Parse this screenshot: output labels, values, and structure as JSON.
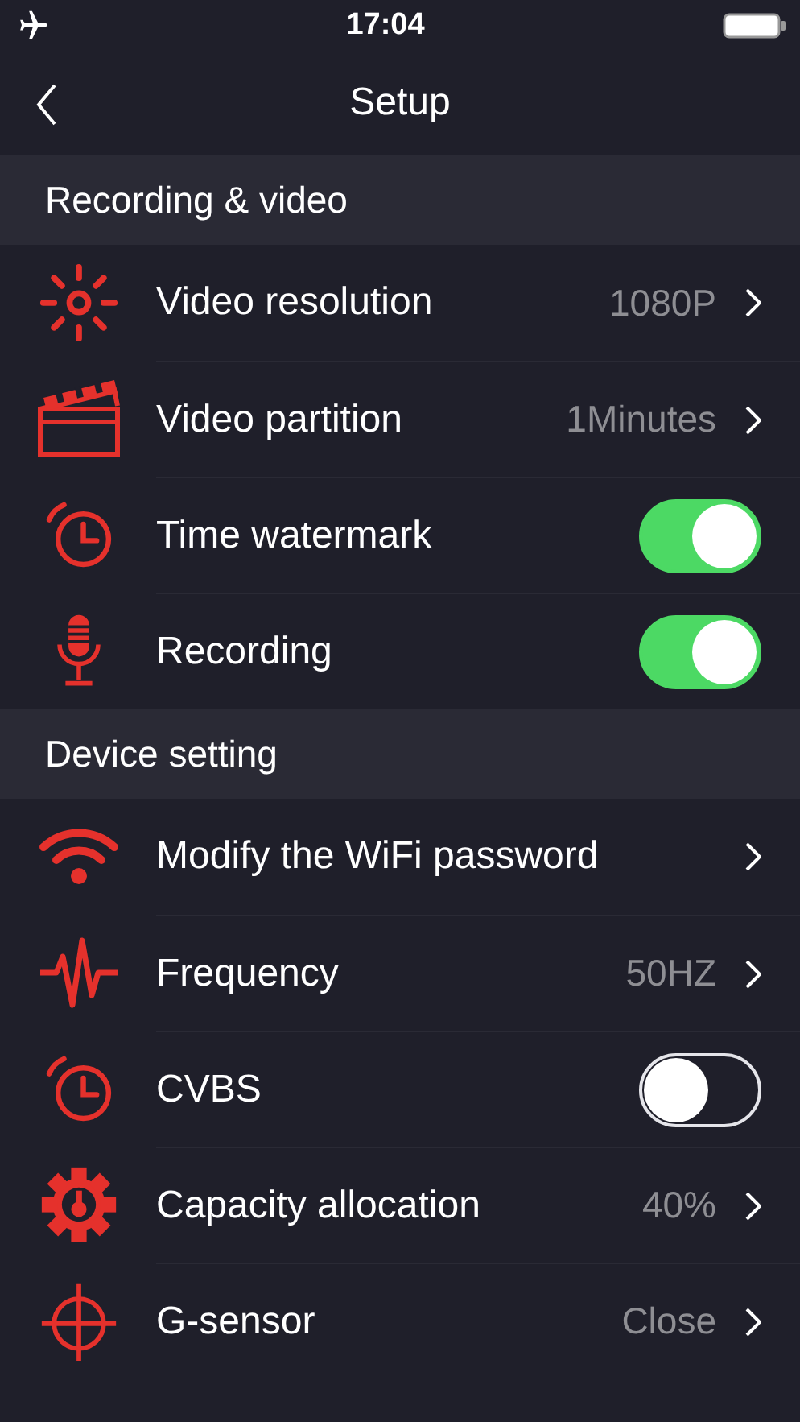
{
  "status_bar": {
    "time": "17:04"
  },
  "nav": {
    "title": "Setup"
  },
  "sections": [
    {
      "title": "Recording & video",
      "items": [
        {
          "label": "Video resolution",
          "kind": "value",
          "value": "1080P"
        },
        {
          "label": "Video partition",
          "kind": "value",
          "value": "1Minutes"
        },
        {
          "label": "Time watermark",
          "kind": "toggle",
          "on": true
        },
        {
          "label": "Recording",
          "kind": "toggle",
          "on": true
        }
      ]
    },
    {
      "title": "Device setting",
      "items": [
        {
          "label": "Modify the WiFi password",
          "kind": "link"
        },
        {
          "label": "Frequency",
          "kind": "value",
          "value": "50HZ"
        },
        {
          "label": "CVBS",
          "kind": "toggle",
          "on": false
        },
        {
          "label": "Capacity allocation",
          "kind": "value",
          "value": "40%"
        },
        {
          "label": "G-sensor",
          "kind": "value",
          "value": "Close"
        }
      ]
    }
  ]
}
